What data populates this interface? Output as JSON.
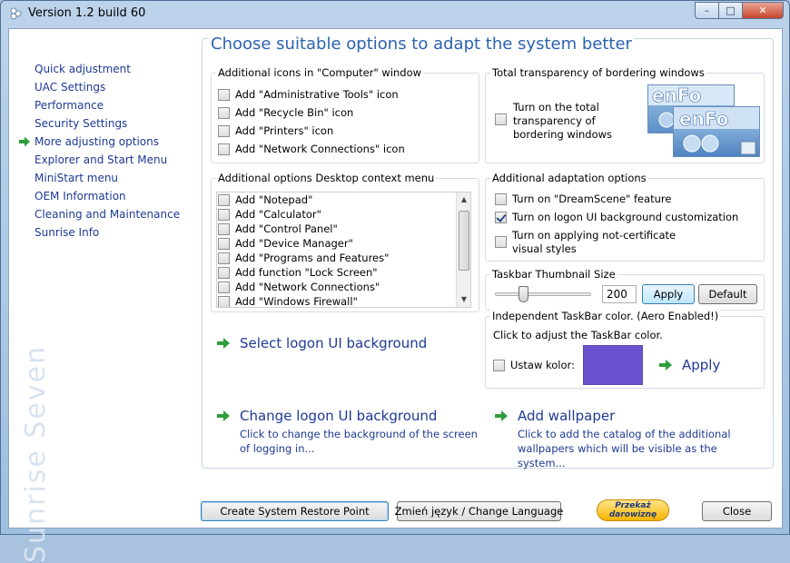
{
  "window": {
    "title": "Version 1.2 build 60"
  },
  "colors": {
    "accent": "#2b63b0",
    "link": "#1e3a94",
    "arrow_green": "#2e9e3a",
    "swatch": "#6a52d0",
    "brand_watermark": "#d8e3f0"
  },
  "icons": {
    "app": "sunrise-app-icon",
    "nav_active": "green-arrow-icon",
    "link": "green-arrow-icon"
  },
  "sidebar": {
    "brand": "Sunrise Seven",
    "items": [
      {
        "label": "Quick adjustment",
        "active": false
      },
      {
        "label": "UAC Settings",
        "active": false
      },
      {
        "label": "Performance",
        "active": false
      },
      {
        "label": "Security Settings",
        "active": false
      },
      {
        "label": "More adjusting options",
        "active": true
      },
      {
        "label": "Explorer and Start Menu",
        "active": false
      },
      {
        "label": "MiniStart menu",
        "active": false
      },
      {
        "label": "OEM Information",
        "active": false
      },
      {
        "label": "Cleaning and Maintenance",
        "active": false
      },
      {
        "label": "Sunrise Info",
        "active": false
      }
    ]
  },
  "main": {
    "heading": "Choose suitable options to adapt the system better",
    "computer_icons": {
      "title": "Additional icons in \"Computer\" window",
      "items": [
        {
          "label": "Add \"Administrative Tools\" icon",
          "checked": false
        },
        {
          "label": "Add \"Recycle Bin\" icon",
          "checked": false
        },
        {
          "label": "Add \"Printers\" icon",
          "checked": false
        },
        {
          "label": "Add \"Network Connections\" icon",
          "checked": false
        }
      ]
    },
    "transparency": {
      "title": "Total transparency of bordering windows",
      "checkbox_label": "Turn on the total transparency of bordering windows",
      "checked": false
    },
    "desktop_menu": {
      "title": "Additional options Desktop context menu",
      "items": [
        {
          "label": "Add \"Notepad\"",
          "checked": false
        },
        {
          "label": "Add \"Calculator\"",
          "checked": false
        },
        {
          "label": "Add \"Control Panel\"",
          "checked": false
        },
        {
          "label": "Add \"Device Manager\"",
          "checked": false
        },
        {
          "label": "Add \"Programs and Features\"",
          "checked": false
        },
        {
          "label": "Add function \"Lock Screen\"",
          "checked": false
        },
        {
          "label": "Add \"Network Connections\"",
          "checked": false
        },
        {
          "label": "Add \"Windows Firewall\"",
          "checked": false
        }
      ]
    },
    "adaptation": {
      "title": "Additional adaptation options",
      "items": [
        {
          "label": "Turn on \"DreamScene\" feature",
          "checked": false
        },
        {
          "label": "Turn on logon UI background customization",
          "checked": true
        },
        {
          "label": "Turn on applying not-certificate visual styles",
          "checked": false
        }
      ]
    },
    "thumbnail": {
      "title": "Taskbar Thumbnail Size",
      "value": "200",
      "slider_fraction": 0.27,
      "apply_label": "Apply",
      "default_label": "Default"
    },
    "taskbar_color": {
      "title": "Independent TaskBar color. (Aero Enabled!)",
      "hint": "Click to adjust the TaskBar color.",
      "checkbox_label": "Ustaw kolor:",
      "checked": false,
      "color": "#6a52d0",
      "apply_label": "Apply"
    },
    "links": {
      "select_logon": {
        "title": "Select logon UI background"
      },
      "change_logon": {
        "title": "Change logon UI background",
        "desc": "Click to change the background of the screen of logging in..."
      },
      "add_wallpaper": {
        "title": "Add wallpaper",
        "desc": "Click to add the catalog of the additional wallpapers which will be visible as the system..."
      }
    }
  },
  "footer": {
    "restore_label": "Create System Restore Point",
    "language_label": "Zmień język / Change Language",
    "donate_line1": "Przekaż",
    "donate_line2": "darowiznę",
    "close_label": "Close"
  }
}
